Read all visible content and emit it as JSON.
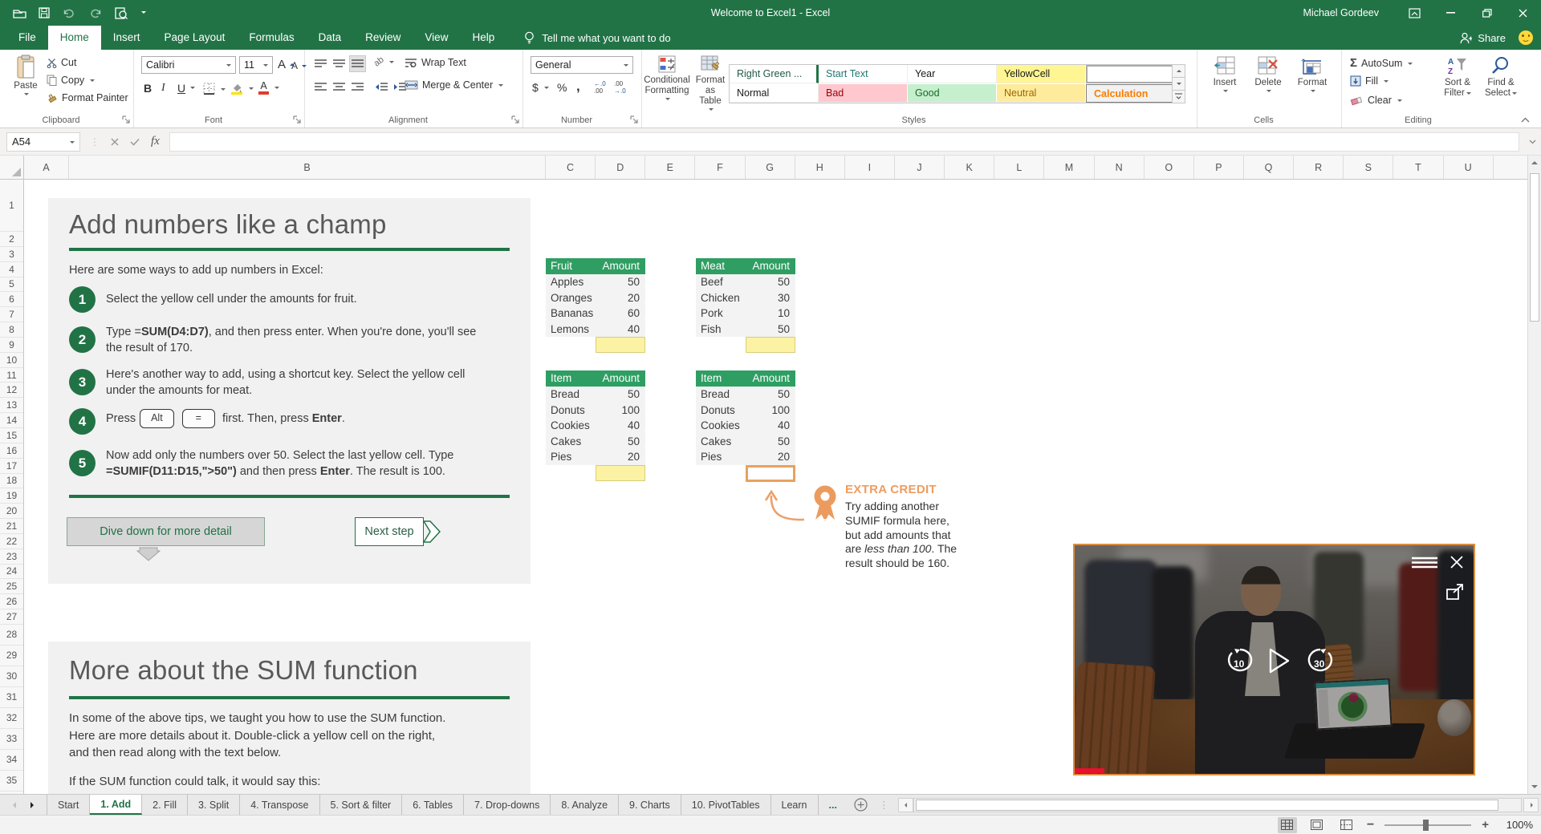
{
  "titlebar": {
    "title": "Welcome to Excel1 - Excel",
    "user": "Michael Gordeev",
    "share": "Share"
  },
  "ribbon": {
    "tabs": [
      {
        "label": "File"
      },
      {
        "label": "Home",
        "cls": "active"
      },
      {
        "label": "Insert"
      },
      {
        "label": "Page Layout"
      },
      {
        "label": "Formulas"
      },
      {
        "label": "Data"
      },
      {
        "label": "Review"
      },
      {
        "label": "View"
      },
      {
        "label": "Help"
      }
    ],
    "tell_me": "Tell me what you want to do",
    "clipboard": {
      "label": "Clipboard",
      "paste": "Paste",
      "cut": "Cut",
      "copy": "Copy",
      "format_painter": "Format Painter"
    },
    "font": {
      "label": "Font",
      "name": "Calibri",
      "size": "11"
    },
    "alignment": {
      "label": "Alignment",
      "wrap": "Wrap Text",
      "merge": "Merge & Center"
    },
    "number": {
      "label": "Number",
      "format": "General"
    },
    "styles": {
      "label": "Styles",
      "cf1": "Conditional",
      "cf2": "Formatting",
      "fat1": "Format as",
      "fat2": "Table",
      "gallery": [
        {
          "label": "Right Green ...",
          "fg": "#215b45",
          "cls": "sg-rg"
        },
        {
          "label": "Start Text",
          "fg": "#1f7872"
        },
        {
          "label": "Year",
          "fg": "#1a1a1a"
        },
        {
          "label": "YellowCell",
          "fg": "#1a1a1a",
          "bg": "#FFF693",
          "cls": "sg-yel"
        },
        {
          "label": "",
          "cls": "sg-sel"
        },
        {
          "label": "Normal",
          "fg": "#1a1a1a"
        },
        {
          "label": "Bad",
          "fg": "#9C0006",
          "bg": "#FFC7CE",
          "cls": "sg-bad"
        },
        {
          "label": "Good",
          "fg": "#176B24",
          "bg": "#C6EFCE",
          "cls": "sg-good"
        },
        {
          "label": "Neutral",
          "fg": "#9C6500",
          "bg": "#FFEB9C",
          "cls": "sg-neu"
        },
        {
          "label": "Calculation",
          "fg": "#FA7D00",
          "bg": "#F2F2F2",
          "cls": "sg-calc"
        }
      ]
    },
    "cells": {
      "label": "Cells",
      "insert": "Insert",
      "del": "Delete",
      "format": "Format"
    },
    "editing": {
      "label": "Editing",
      "autosum": "AutoSum",
      "fill": "Fill",
      "clear": "Clear",
      "sort1": "Sort &",
      "sort2": "Filter",
      "find1": "Find &",
      "find2": "Select"
    }
  },
  "icons": {
    "bold": "B",
    "italic": "I",
    "underline": "U",
    "dollar": "$",
    "percent": "%",
    "comma": ",",
    "autosum": "Σ",
    "font_a": "A",
    "orientation": "ab",
    "fx": "fx",
    "inc_top": "←.0",
    "inc_bot": ".00",
    "dec_top": ".00",
    "dec_bot": "→.0"
  },
  "formula_bar": {
    "name_box": "A54"
  },
  "grid": {
    "columns": [
      "A",
      "B",
      "C",
      "D",
      "E",
      "F",
      "G",
      "H",
      "I",
      "J",
      "K",
      "L",
      "M",
      "N",
      "O",
      "P",
      "Q",
      "R",
      "S",
      "T",
      "U"
    ],
    "rows": [
      1,
      2,
      3,
      4,
      5,
      6,
      7,
      8,
      9,
      10,
      11,
      12,
      13,
      14,
      15,
      16,
      17,
      18,
      19,
      20,
      21,
      22,
      23,
      24,
      25,
      26,
      27,
      28,
      29,
      30,
      31,
      32,
      33,
      34,
      35
    ]
  },
  "sheet": {
    "card1": {
      "title": "Add numbers like a champ",
      "intro": "Here are some ways to add up numbers in Excel:",
      "steps": {
        "s1": {
          "num": "1",
          "text": "Select the yellow cell under the amounts for fruit."
        },
        "s2": {
          "num": "2",
          "t1": "Type =",
          "b1": "SUM(D4:D7)",
          "t2": ", and then press enter. When you're done, you'll see the result of 170."
        },
        "s3": {
          "num": "3",
          "text": "Here's another way to add, using a shortcut key. Select the yellow cell under the amounts for meat."
        },
        "s4": {
          "num": "4",
          "t1": "Press",
          "key1": "Alt",
          "key2": "=",
          "t2": " first. Then, press ",
          "b1": "Enter",
          "t3": "."
        },
        "s5": {
          "num": "5",
          "t1": "Now add only the numbers over 50. Select the last yellow cell. Type ",
          "b1": "=SUMIF(D11:D15,\">50\")",
          "t2": " and then press ",
          "b2": "Enter",
          "t3": ". The result is 100."
        }
      },
      "dive_button": "Dive down for more detail",
      "next_button": "Next step"
    },
    "tables": {
      "fruit": {
        "col1": "Fruit",
        "col2": "Amount",
        "rows": [
          {
            "name": "Apples",
            "amount": "50"
          },
          {
            "name": "Oranges",
            "amount": "20"
          },
          {
            "name": "Bananas",
            "amount": "60"
          },
          {
            "name": "Lemons",
            "amount": "40"
          }
        ]
      },
      "meat": {
        "col1": "Meat",
        "col2": "Amount",
        "rows": [
          {
            "name": "Beef",
            "amount": "50"
          },
          {
            "name": "Chicken",
            "amount": "30"
          },
          {
            "name": "Pork",
            "amount": "10"
          },
          {
            "name": "Fish",
            "amount": "50"
          }
        ]
      },
      "bakery": {
        "col1": "Item",
        "col2": "Amount",
        "rows": [
          {
            "name": "Bread",
            "amount": "50"
          },
          {
            "name": "Donuts",
            "amount": "100"
          },
          {
            "name": "Cookies",
            "amount": "40"
          },
          {
            "name": "Cakes",
            "amount": "50"
          },
          {
            "name": "Pies",
            "amount": "20"
          }
        ]
      }
    },
    "extra_credit": {
      "heading": "EXTRA CREDIT",
      "t1": "Try adding another SUMIF formula here, but add amounts that are ",
      "em": "less than 100",
      "t2": ". The result should be 160."
    },
    "card2": {
      "title": "More about the SUM function",
      "p1": "In some of the above tips, we taught you how to use the SUM function. Here are more details about it. Double-click a yellow cell on the right, and then read along with the text below.",
      "p2": "If the SUM function could talk, it would say this:"
    }
  },
  "video": {
    "rewind": "10",
    "forward": "30"
  },
  "sheet_tabs": {
    "items": [
      {
        "label": "Start"
      },
      {
        "label": "1. Add",
        "cls": "active"
      },
      {
        "label": "2. Fill"
      },
      {
        "label": "3. Split"
      },
      {
        "label": "4. Transpose"
      },
      {
        "label": "5. Sort & filter"
      },
      {
        "label": "6. Tables"
      },
      {
        "label": "7. Drop-downs"
      },
      {
        "label": "8. Analyze"
      },
      {
        "label": "9. Charts"
      },
      {
        "label": "10. PivotTables"
      },
      {
        "label": "Learn"
      }
    ],
    "overflow": "..."
  },
  "status_bar": {
    "zoom": "100%"
  },
  "colors": {
    "excel_green": "#217346",
    "table_header_green": "#2F9E63",
    "accent_orange": "#ED9D60",
    "yellow_cell": "#FBF3A3",
    "progress_red": "#E81123"
  }
}
